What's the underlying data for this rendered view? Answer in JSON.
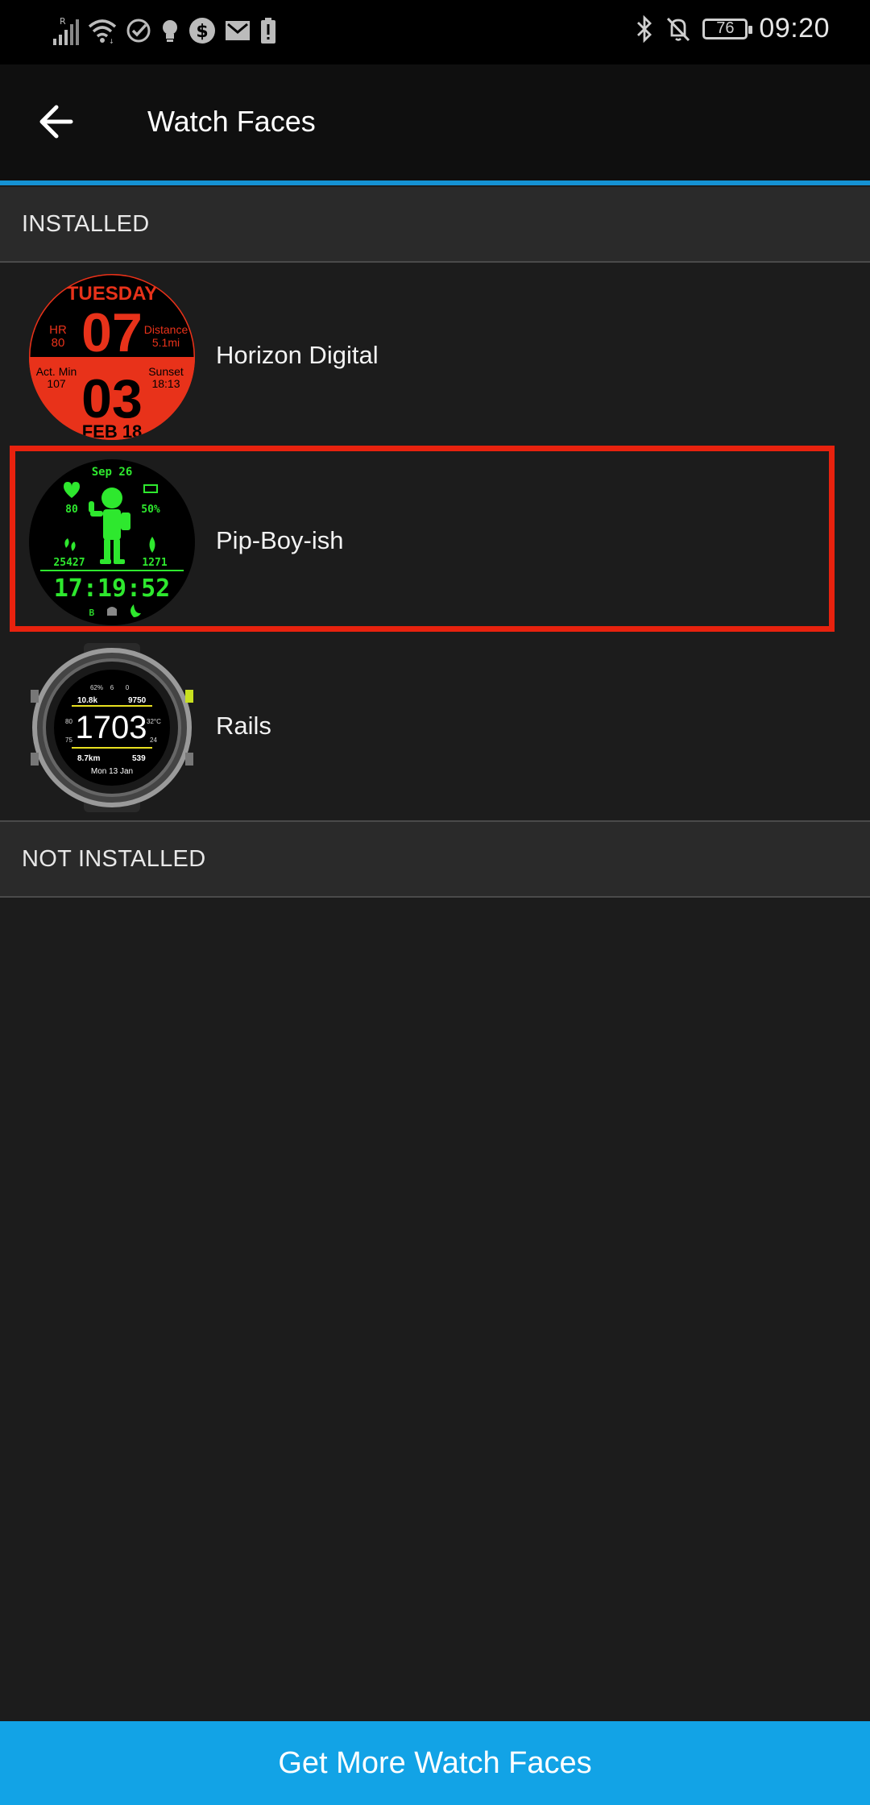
{
  "status_bar": {
    "time": "09:20",
    "battery_level": "76",
    "left_icons": [
      "signal-icon",
      "wifi-icon",
      "check-circle-icon",
      "lightbulb-icon",
      "dollar-icon",
      "mail-icon",
      "battery-alert-icon"
    ],
    "right_icons": [
      "bluetooth-icon",
      "bell-off-icon",
      "battery-icon"
    ],
    "roaming_indicator": "R"
  },
  "app_bar": {
    "title": "Watch Faces",
    "back_icon": "arrow-left-icon"
  },
  "colors": {
    "accent": "#1592d3",
    "button": "#12a3e6",
    "highlight": "#e8220e",
    "background": "#1c1c1c"
  },
  "sections": {
    "installed_label": "INSTALLED",
    "not_installed_label": "NOT INSTALLED"
  },
  "installed": [
    {
      "name": "Horizon Digital",
      "preview": {
        "day": "TUESDAY",
        "hour": "07",
        "minute": "03",
        "date": "FEB 18",
        "hr_label": "HR",
        "hr_value": "80",
        "dist_label": "Distance",
        "dist_value": "5.1mi",
        "act_label": "Act. Min",
        "act_value": "107",
        "sunset_label": "Sunset",
        "sunset_value": "18:13"
      }
    },
    {
      "name": "Pip-Boy-ish",
      "selected": true,
      "preview": {
        "date": "Sep 26",
        "heart": "80",
        "battery": "50%",
        "steps": "25427",
        "calories": "1271",
        "time": "17:19:52"
      }
    },
    {
      "name": "Rails",
      "preview": {
        "steps": "10.8k",
        "floors": "9750",
        "time": "1703",
        "temp": "32°C",
        "distance": "8.7km",
        "calories": "539",
        "date": "Mon 13 Jan",
        "top_a": "62%",
        "top_b": "6",
        "top_c": "0",
        "left_a": "80",
        "left_b": "75",
        "right_a": "24"
      }
    }
  ],
  "bottom_button": {
    "label": "Get More Watch Faces"
  }
}
